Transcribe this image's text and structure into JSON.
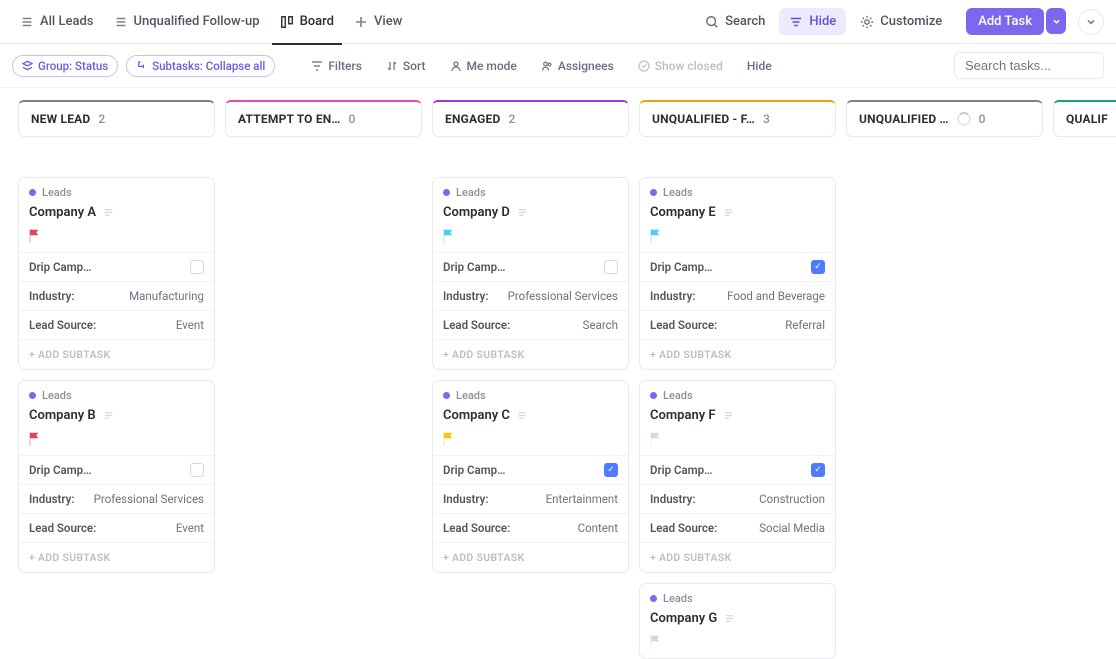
{
  "nav": {
    "all_leads": "All Leads",
    "unqualified_followup": "Unqualified Follow-up",
    "board": "Board",
    "view": "View",
    "search": "Search",
    "hide": "Hide",
    "customize": "Customize",
    "add_task": "Add Task"
  },
  "toolbar": {
    "group": "Group: Status",
    "subtasks": "Subtasks: Collapse all",
    "filters": "Filters",
    "sort": "Sort",
    "me_mode": "Me mode",
    "assignees": "Assignees",
    "show_closed": "Show closed",
    "hide": "Hide",
    "search_placeholder": "Search tasks..."
  },
  "columns": [
    {
      "label": "NEW LEAD",
      "count": "2",
      "color": "#7c828d"
    },
    {
      "label": "ATTEMPT TO EN…",
      "count": "0",
      "color": "#e948ae"
    },
    {
      "label": "ENGAGED",
      "count": "2",
      "color": "#a233e6"
    },
    {
      "label": "UNQUALIFIED - F…",
      "count": "3",
      "color": "#f59e0b"
    },
    {
      "label": "UNQUALIFIED …",
      "count": "0",
      "color": "#7c828d",
      "progress": true
    },
    {
      "label": "QUALIF",
      "count": "",
      "color": "#0aa678"
    }
  ],
  "labels": {
    "leads": "Leads",
    "drip": "Drip Camp…",
    "industry": "Industry:",
    "source": "Lead Source:",
    "addsub": "+ ADD SUBTASK"
  },
  "cards": {
    "newlead": [
      {
        "title": "Company A",
        "flag": "#e2445c",
        "drip": false,
        "industry": "Manufacturing",
        "source": "Event"
      },
      {
        "title": "Company B",
        "flag": "#e2445c",
        "drip": false,
        "industry": "Professional Services",
        "source": "Event"
      }
    ],
    "engaged": [
      {
        "title": "Company D",
        "flag": "#49ccf9",
        "drip": false,
        "industry": "Professional Services",
        "source": "Search"
      },
      {
        "title": "Company C",
        "flag": "#f5c518",
        "drip": true,
        "industry": "Entertainment",
        "source": "Content"
      }
    ],
    "unqualified_f": [
      {
        "title": "Company E",
        "flag": "#49ccf9",
        "drip": true,
        "industry": "Food and Beverage",
        "source": "Referral"
      },
      {
        "title": "Company F",
        "flag": "#d5d9df",
        "drip": true,
        "industry": "Construction",
        "source": "Social Media"
      },
      {
        "title": "Company G",
        "flag": "#d5d9df"
      }
    ]
  }
}
